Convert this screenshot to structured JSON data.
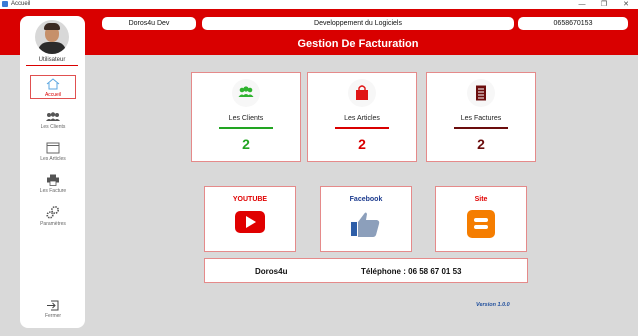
{
  "window": {
    "title": "Accueil",
    "minimize": "—",
    "restore": "❐",
    "close": "✕"
  },
  "header": {
    "user_name": "Doros4u Dev",
    "company": "Developpement du Logiciels",
    "phone": "0658670153",
    "app_title": "Gestion De Facturation"
  },
  "sidebar": {
    "user_label": "Utilisateur",
    "items": [
      {
        "label": "Accueil",
        "icon": "home-icon",
        "active": true
      },
      {
        "label": "Les Clients",
        "icon": "users-icon"
      },
      {
        "label": "Les Articles",
        "icon": "window-icon"
      },
      {
        "label": "Les Facture",
        "icon": "printer-icon"
      },
      {
        "label": "Paramètres",
        "icon": "gears-icon"
      }
    ],
    "logout_label": "Fermer"
  },
  "cards": [
    {
      "label": "Les Clients",
      "count": "2",
      "color": "#22a522",
      "icon": "users-icon"
    },
    {
      "label": "Les Articles",
      "count": "2",
      "color": "#d90000",
      "icon": "shopping-bag-icon"
    },
    {
      "label": "Les Factures",
      "count": "2",
      "color": "#6b0d0d",
      "icon": "invoice-icon"
    }
  ],
  "social": [
    {
      "label": "YOUTUBE",
      "color": "#e00000",
      "icon": "youtube-icon"
    },
    {
      "label": "Facebook",
      "color": "#1d3c8f",
      "icon": "thumbs-up-icon"
    },
    {
      "label": "Site",
      "color": "#e00000",
      "icon": "blogger-icon"
    }
  ],
  "info": {
    "name": "Doros4u",
    "phone": "Téléphone : 06 58 67 01 53"
  },
  "version": "Version 1.0.0"
}
